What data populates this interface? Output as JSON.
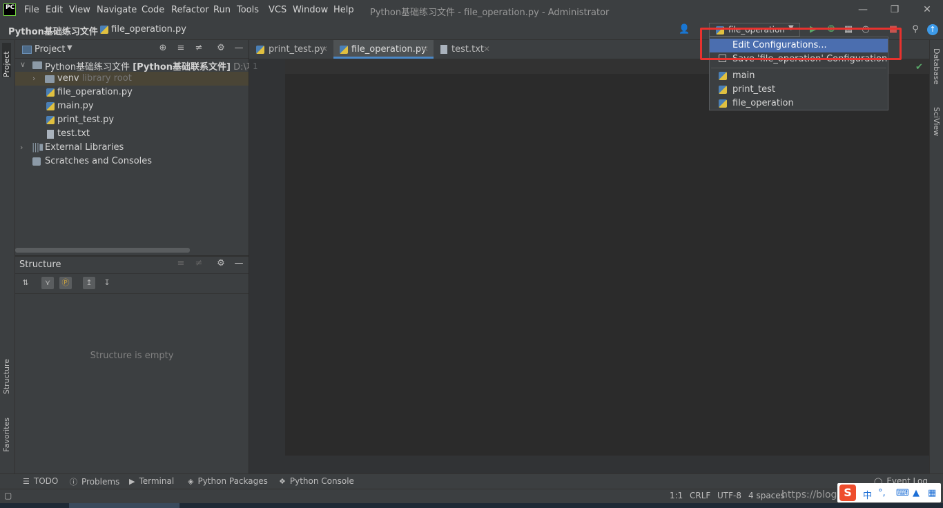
{
  "title_bar": {
    "logo": "PC",
    "menu": [
      "File",
      "Edit",
      "View",
      "Navigate",
      "Code",
      "Refactor",
      "Run",
      "Tools",
      "VCS",
      "Window",
      "Help"
    ],
    "window_title": "Python基础练习文件 - file_operation.py - Administrator"
  },
  "nav": {
    "project": "Python基础练习文件",
    "file": "file_operation.py",
    "run_config": "file_operation"
  },
  "left_stripe": {
    "project": "Project",
    "structure": "Structure",
    "favorites": "Favorites"
  },
  "right_stripe": {
    "database": "Database",
    "sciview": "SciView"
  },
  "project_panel": {
    "title": "Project",
    "tree": {
      "root_name": "Python基础练习文件",
      "root_bold": "[Python基础联系文件]",
      "root_path": "D:\\项目\\",
      "venv": "venv",
      "venv_hint": "library root",
      "files": [
        "file_operation.py",
        "main.py",
        "print_test.py",
        "test.txt"
      ],
      "external": "External Libraries",
      "scratches": "Scratches and Consoles"
    }
  },
  "structure_panel": {
    "title": "Structure",
    "empty": "Structure is empty"
  },
  "editor": {
    "tabs": [
      {
        "label": "print_test.py",
        "active": false
      },
      {
        "label": "file_operation.py",
        "active": true
      },
      {
        "label": "test.txt",
        "active": false
      }
    ],
    "line_number": "1"
  },
  "dropdown": {
    "edit": "Edit Configurations...",
    "save": "Save 'file_operation' Configuration",
    "configs": [
      "main",
      "print_test",
      "file_operation"
    ]
  },
  "bottom_tools": [
    "TODO",
    "Problems",
    "Terminal",
    "Python Packages",
    "Python Console",
    "Event Log"
  ],
  "status": {
    "position": "1:1",
    "line_sep": "CRLF",
    "encoding": "UTF-8",
    "indent": "4 spaces",
    "watermark": "https://blog.csdn.net/..."
  },
  "ime": {
    "s": "S",
    "zh": "中",
    "punct": "°,"
  },
  "colors": {
    "accent": "#4b6eaf",
    "highlight": "#e8322e",
    "run": "#59a869"
  }
}
